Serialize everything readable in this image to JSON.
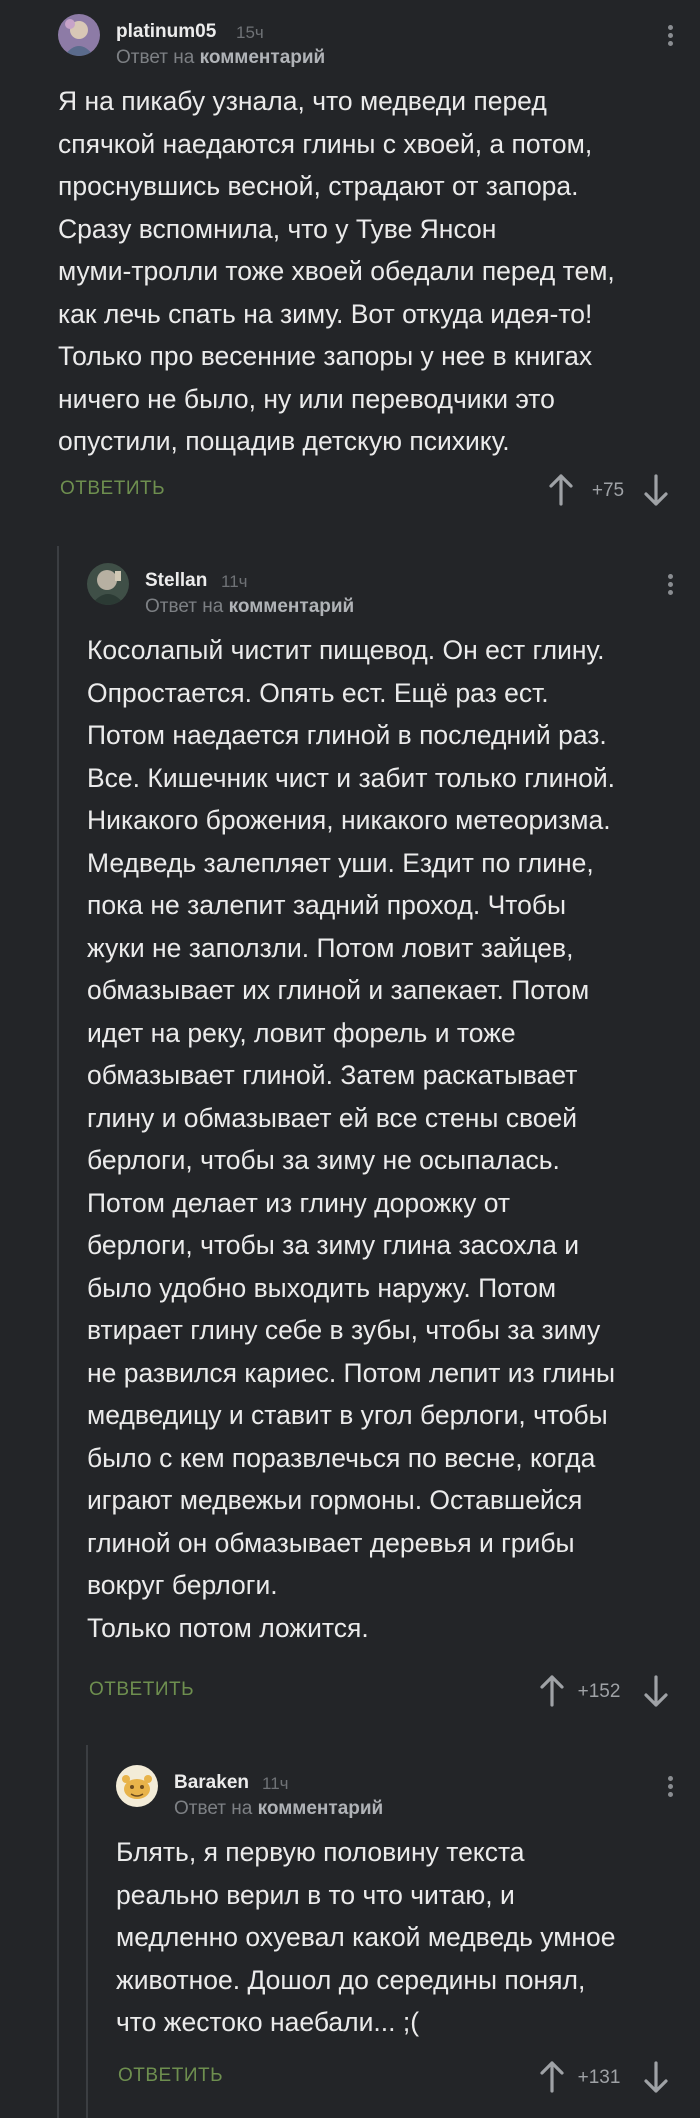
{
  "comments": [
    {
      "author": "platinum05",
      "time": "15ч",
      "reply_prefix": "Ответ на",
      "reply_target": "комментарий",
      "text": "Я на пикабу узнала, что медведи перед\nспячкой наедаются глины с хвоей, а потом,\nпроснувшись весной, страдают от запора.\nСразу вспомнила, что у Туве Янсон\nмуми-тролли тоже хвоей обедали перед тем,\nкак лечь спать на зиму. Вот откуда идея-то!\nТолько про весенние запоры у нее в книгах\nничего не было, ну или переводчики это\nопустили, пощадив детскую психику.",
      "reply_label": "ОТВЕТИТЬ",
      "score": "+75"
    },
    {
      "author": "Stellan",
      "time": "11ч",
      "reply_prefix": "Ответ на",
      "reply_target": "комментарий",
      "text": "Косолапый чистит пищевод. Он ест глину.\nОпростается. Опять ест. Ещё раз ест.\nПотом наедается глиной в последний раз.\nВсе. Кишечник чист и забит только глиной.\nНикакого брожения, никакого метеоризма.\nМедведь залепляет уши. Ездит по глине,\nпока не залепит задний проход. Чтобы\nжуки не заползли. Потом ловит зайцев,\nобмазывает их глиной и запекает. Потом\nидет на реку, ловит форель и тоже\nобмазывает глиной. Затем раскатывает\nглину и обмазывает ей все стены своей\nберлоги, чтобы за зиму не осыпалась.\nПотом делает из глину дорожку от\nберлоги, чтобы за зиму глина засохла и\nбыло удобно выходить наружу. Потом\nвтирает глину себе в зубы, чтобы за зиму\nне развился кариес. Потом лепит из глины\nмедведицу и ставит в угол берлоги, чтобы\nбыло с кем поразвлечься по весне, когда\nиграют медвежьи гормоны. Оставшейся\nглиной он обмазывает деревья и грибы\nвокруг берлоги.\nТолько потом ложится.",
      "reply_label": "ОТВЕТИТЬ",
      "score": "+152"
    },
    {
      "author": "Baraken",
      "time": "11ч",
      "reply_prefix": "Ответ на",
      "reply_target": "комментарий",
      "text": "Блять, я первую половину текста\nреально верил в то что читаю, и\nмедленно охуевал какой медведь умное\nживотное. Дошол до середины понял,\nчто жестоко наебали... ;(",
      "reply_label": "ОТВЕТИТЬ",
      "score": "+131"
    }
  ],
  "icons": {
    "menu": "kebab-menu-icon",
    "upvote": "arrow-up-icon",
    "downvote": "arrow-down-icon"
  },
  "colors": {
    "background": "#232528",
    "reply_button": "#6e8f4f",
    "thread_line": "#3b3e42"
  }
}
